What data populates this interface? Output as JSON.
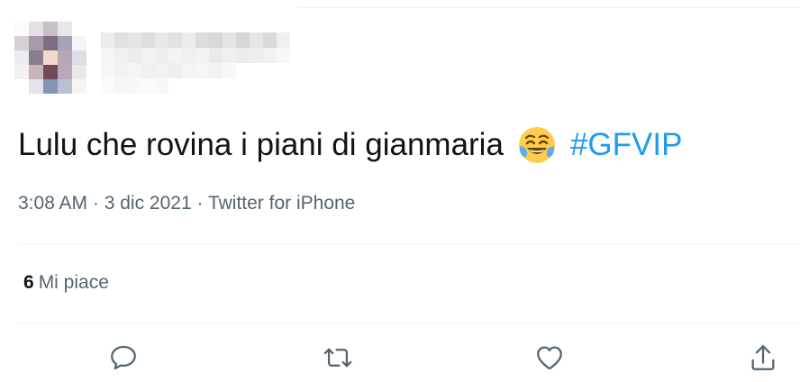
{
  "tweet": {
    "text": "Lulu che rovina i piani di gianmaria",
    "emoji": "face-with-tears-of-joy",
    "hashtag": "#GFVIP",
    "time": "3:08 AM",
    "date": "3 dic 2021",
    "source": "Twitter for iPhone",
    "separator": " · "
  },
  "stats": {
    "likes_count": "6",
    "likes_label": "Mi piace"
  },
  "actions": [
    {
      "name": "reply",
      "icon": "reply-icon"
    },
    {
      "name": "retweet",
      "icon": "retweet-icon"
    },
    {
      "name": "like",
      "icon": "heart-icon"
    },
    {
      "name": "share",
      "icon": "share-icon"
    }
  ],
  "colors": {
    "text": "#0f1419",
    "secondary": "#536471",
    "link": "#1d9bf0",
    "divider": "#eff3f4",
    "icon": "#536471"
  }
}
